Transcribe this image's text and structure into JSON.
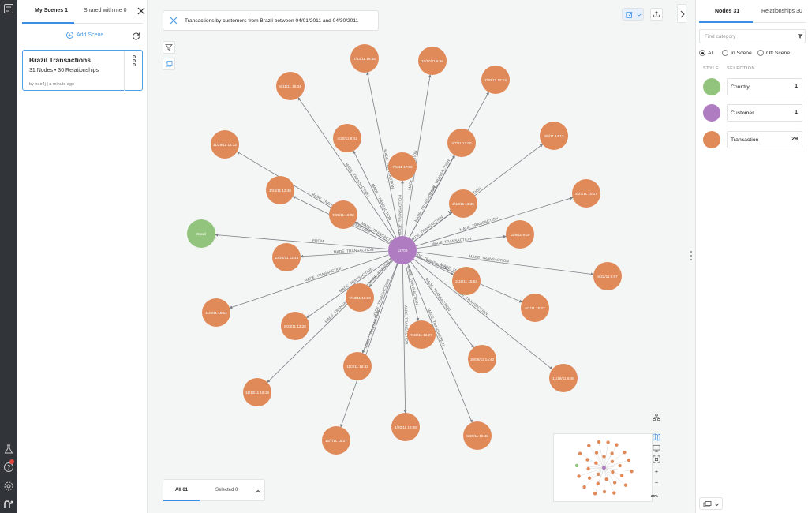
{
  "scenes_panel": {
    "tabs": [
      {
        "label": "My Scenes 1"
      },
      {
        "label": "Shared with me 0"
      }
    ],
    "add_scene_label": "Add Scene",
    "card": {
      "title": "Brazil Transactions",
      "summary": "31 Nodes • 30 Relationships",
      "meta": "by neo4j | a minute ago"
    }
  },
  "canvas": {
    "query": "Transactions by customers from Brazil between 04/01/2011 and 04/30/2011",
    "bottom_tabs": [
      {
        "label": "All 61"
      },
      {
        "label": "Selected 0"
      }
    ],
    "zoom_level": "20%"
  },
  "right_panel": {
    "tabs": [
      {
        "label": "Nodes 31"
      },
      {
        "label": "Relationships 30"
      }
    ],
    "filter_placeholder": "Find category",
    "radios": [
      {
        "label": "All"
      },
      {
        "label": "In Scene"
      },
      {
        "label": "Off Scene"
      }
    ],
    "selected_radio": "All",
    "headers": {
      "style": "STYLE",
      "selection": "SELECTION"
    },
    "categories": [
      {
        "label": "Country",
        "count": "1",
        "color": "#93c47d"
      },
      {
        "label": "Customer",
        "count": "1",
        "color": "#b07cc1"
      },
      {
        "label": "Transaction",
        "count": "29",
        "color": "#e08a5a"
      }
    ]
  },
  "graph": {
    "colors": {
      "transaction": "#e08a5a",
      "customer": "#b07cc1",
      "country": "#93c47d",
      "edge": "#7d8085"
    },
    "customer_label": "12709",
    "country_label": "Brazil",
    "country_edge_label": "FROM",
    "transaction_edge_label": "MADE_TRANSACTION",
    "transactions": [
      "7/14/11 16:46",
      "10/10/11 6:56",
      "8/11/11 15:34",
      "7/30/11 10:13",
      "4/20/11 8:41",
      "4/7/11 17:00",
      "4/6/11 14:12",
      "11/29/11 14:32",
      "7/5/11 17:59",
      "1/24/11 12:48",
      "4/10/11 13:35",
      "4/27/11 10:17",
      "7/29/11 16:00",
      "11/6/11 9:29",
      "10/28/11 12:44",
      "8/22/11 8:57",
      "2/18/11 15:53",
      "7/13/11 16:20",
      "6/1/11 15:27",
      "11/8/11 18:14",
      "8/23/11 13:28",
      "7/15/11 16:27",
      "10/06/11 14:42",
      "11/3/11 16:33",
      "11/18/11 6:48",
      "11/10/11 16:16",
      "1/20/11 16:08",
      "8/20/11 16:48",
      "10/7/11 15:27"
    ]
  }
}
